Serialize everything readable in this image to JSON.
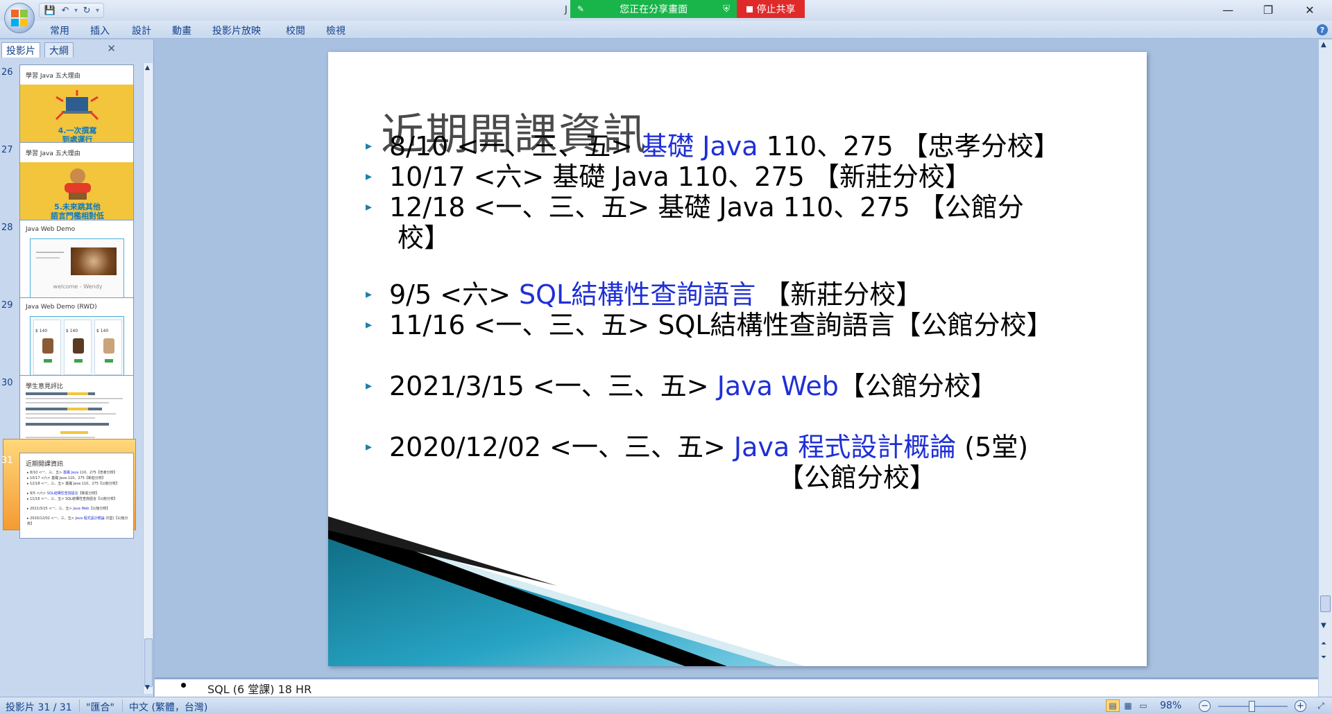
{
  "window": {
    "title_fragment": "J",
    "minimize_glyph": "—",
    "restore_glyph": "❐",
    "close_glyph": "✕"
  },
  "share": {
    "status": "您正在分享畫面",
    "stop": "停止共享"
  },
  "ribbon": {
    "tabs": [
      "常用",
      "插入",
      "設計",
      "動畫",
      "投影片放映",
      "校閱",
      "檢視"
    ],
    "help": "?"
  },
  "panel": {
    "tab_slides": "投影片",
    "tab_outline": "大綱",
    "close": "✕"
  },
  "thumbnails": [
    {
      "number": "26",
      "title": "學習 Java 五大理由",
      "caption_lines": [
        "4.一次撰寫",
        "到處運行"
      ]
    },
    {
      "number": "27",
      "title": "學習 Java 五大理由",
      "caption_lines": [
        "5.未來跳其他",
        "語言門檻相對低"
      ]
    },
    {
      "number": "28",
      "title": "Java Web Demo",
      "caption_lines": [
        "welcome - Wendy"
      ]
    },
    {
      "number": "29",
      "title": "Java Web Demo (RWD)",
      "caption_lines": [
        "$ 140",
        "$ 140",
        "$ 140"
      ]
    },
    {
      "number": "30",
      "title": "學生意見評比",
      "caption_lines": []
    },
    {
      "number": "31",
      "title": "近期開課資訊",
      "caption_lines": []
    }
  ],
  "slide": {
    "title": "近期開課資訊",
    "bullets": [
      {
        "parts": [
          {
            "t": "8/10 <一、三、五>  ",
            "blue": false
          },
          {
            "t": "基礎 Java",
            "blue": true
          },
          {
            "t": "  110、275 【忠孝分校】",
            "blue": false
          }
        ]
      },
      {
        "parts": [
          {
            "t": "10/17 <六>  基礎 Java  110、275 【新莊分校】",
            "blue": false
          }
        ]
      },
      {
        "parts": [
          {
            "t": "12/18  <一、三、五>  基礎 Java  110、275 【公館分",
            "blue": false
          }
        ],
        "continuation": "校】"
      },
      {
        "parts": [
          {
            "t": "9/5 <六>  ",
            "blue": false
          },
          {
            "t": "SQL結構性查詢語言",
            "blue": true
          },
          {
            "t": " 【新莊分校】",
            "blue": false
          }
        ]
      },
      {
        "parts": [
          {
            "t": "11/16 <一、三、五> SQL結構性查詢語言【公館分校】",
            "blue": false
          }
        ]
      },
      {
        "parts": [
          {
            "t": "2021/3/15 <一、三、五>  ",
            "blue": false
          },
          {
            "t": "Java Web",
            "blue": true
          },
          {
            "t": "【公館分校】",
            "blue": false
          }
        ]
      },
      {
        "parts": [
          {
            "t": "2020/12/02 <一、三、五> ",
            "blue": false
          },
          {
            "t": "Java 程式設計概論",
            "blue": true
          },
          {
            "t": " (5堂)",
            "blue": false
          }
        ],
        "continuation": "【公館分校】"
      }
    ]
  },
  "notes": {
    "text": "SQL (6 堂課) 18 HR"
  },
  "status": {
    "slide_counter": "投影片 31 / 31",
    "theme": "\"匯合\"",
    "language": "中文 (繁體，台灣)",
    "zoom": "98%",
    "zoom_fraction": 0.49
  },
  "colors": {
    "accent_blue": "#1f2fd6",
    "share_green": "#19b54a",
    "share_red": "#e02a2a",
    "selected_orange": "#f59a33"
  }
}
